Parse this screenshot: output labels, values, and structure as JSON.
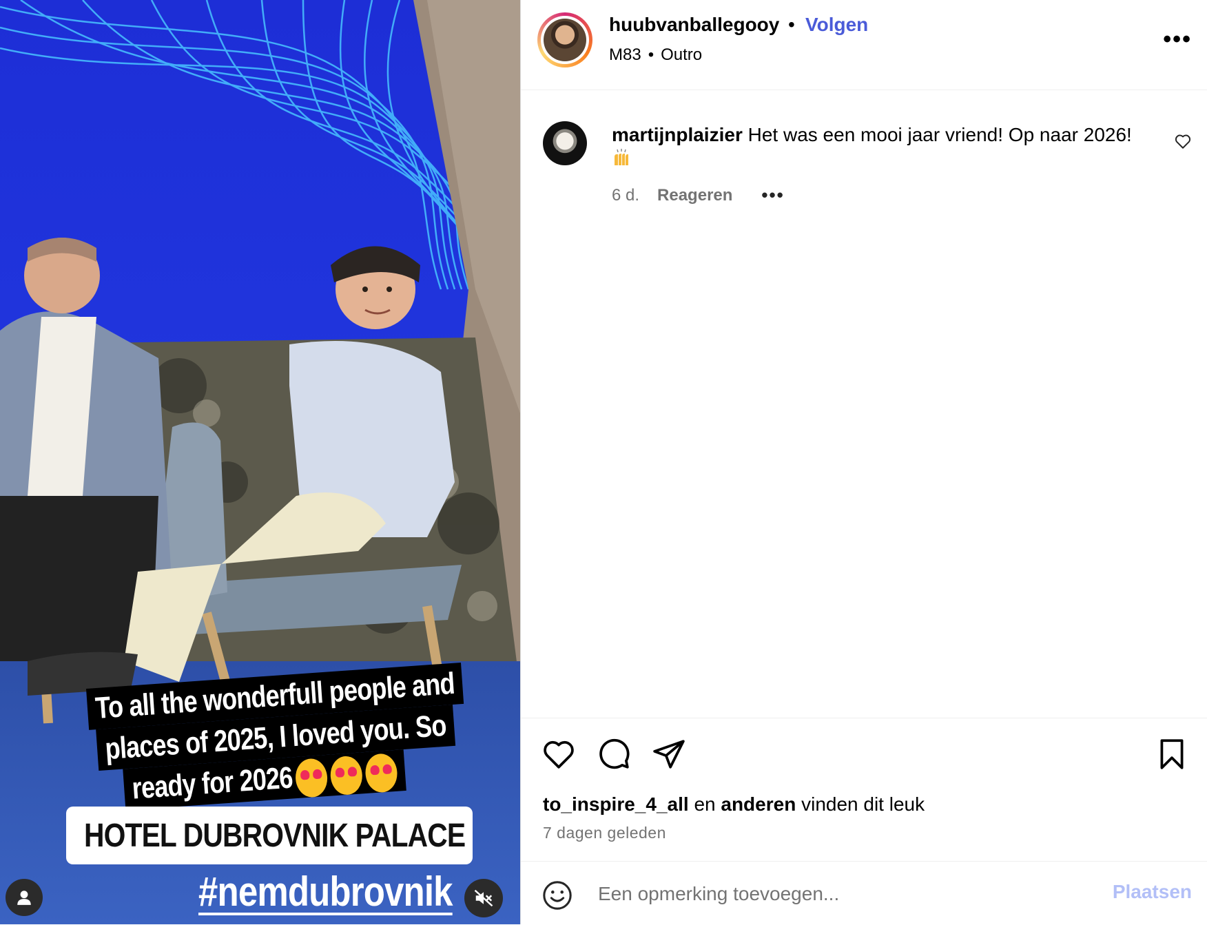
{
  "media": {
    "caption_lines": [
      "To all the wonderfull people and",
      "places of 2025, I loved you. So",
      "ready for 2026"
    ],
    "location_sticker": "HOTEL DUBROVNIK PALACE",
    "hashtag": "#nemdubrovnik",
    "icons": {
      "tag": "user-icon",
      "mute": "speaker-muted-icon"
    }
  },
  "header": {
    "username": "huubvanballegooy",
    "separator": "•",
    "follow_label": "Volgen",
    "music_artist": "M83",
    "music_separator": "•",
    "music_track": "Outro",
    "more": "•••"
  },
  "comment": {
    "username": "martijnplaizier",
    "text": "Het was een mooi jaar vriend! Op naar 2026!",
    "time": "6 d.",
    "reply_label": "Reageren",
    "more": "•••"
  },
  "footer": {
    "liked_by_user": "to_inspire_4_all",
    "liked_by_connector": "en",
    "liked_by_others": "anderen",
    "liked_by_suffix": "vinden dit leuk",
    "timestamp": "7 dagen geleden",
    "composer_placeholder": "Een opmerking toevoegen...",
    "post_label": "Plaatsen",
    "icons": [
      "heart-icon",
      "comment-icon",
      "share-icon",
      "bookmark-icon"
    ]
  },
  "colors": {
    "follow": "#4a5bd8",
    "post_disabled": "#b2bff7",
    "muted_text": "#737373"
  }
}
